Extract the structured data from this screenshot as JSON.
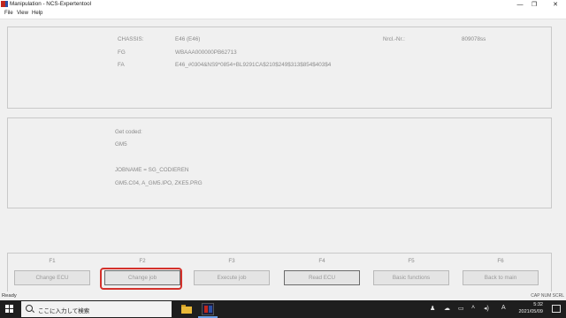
{
  "window": {
    "title": "Manipulation - NCS-Expertentool",
    "minimize": "—",
    "maximize": "❐",
    "close": "✕"
  },
  "menu": [
    "File",
    "View",
    "Help"
  ],
  "vehicle_info": {
    "chassis_label": "CHASSIS:",
    "chassis_value": "E46 (E46)",
    "fg_label": "FG",
    "fg_value": "WBAAA000000PB62713",
    "fa_label": "FA",
    "fa_value": "E46_#0304&NS9*0854+BL9291CA$210$249$313$854$403$4",
    "nrcl_label": "Nrcl.-Nr.:",
    "nrcl_value": "809078ss"
  },
  "coding_info": {
    "get_coded": "Get coded:",
    "module": "GM5",
    "jobname": "JOBNAME = SG_CODIEREN",
    "file_line": "GM5.C04, A_GM5.IPO, ZKE5.PRG"
  },
  "function_keys": [
    {
      "key": "F1",
      "label": "Change ECU"
    },
    {
      "key": "F2",
      "label": "Change job"
    },
    {
      "key": "F3",
      "label": "Execute job"
    },
    {
      "key": "F4",
      "label": "Read ECU"
    },
    {
      "key": "F5",
      "label": "Basic functions"
    },
    {
      "key": "F6",
      "label": "Back to main"
    }
  ],
  "status": {
    "left": "Ready",
    "right": "CAP NUM SCRL"
  },
  "taskbar": {
    "search_placeholder": "ここに入力して検索",
    "time": "5:32",
    "date": "2021/05/09",
    "ime": "A",
    "icons": [
      "windows-logo-icon",
      "search-icon",
      "folder-icon",
      "ncs-app-icon"
    ]
  },
  "colors": {
    "highlight": "#d4312b",
    "taskbar": "#1e1e1e"
  }
}
